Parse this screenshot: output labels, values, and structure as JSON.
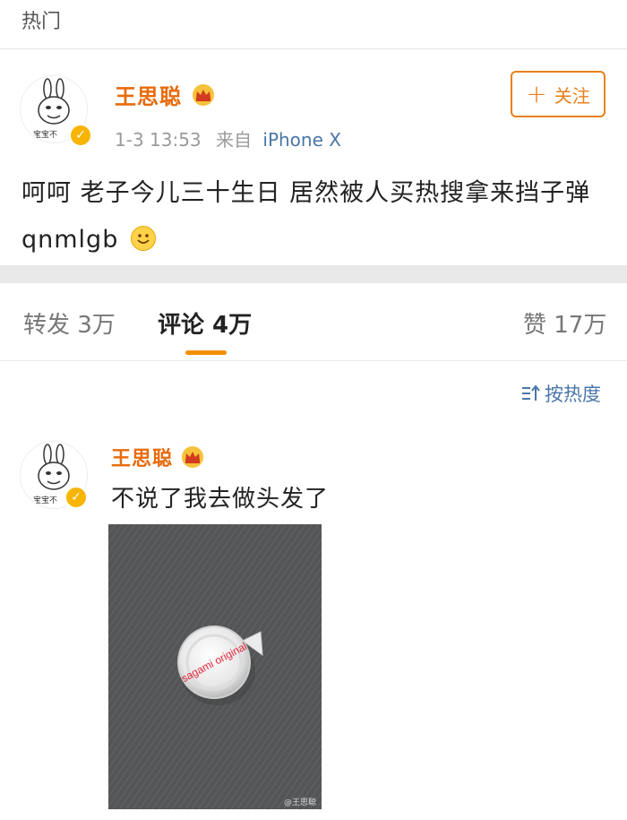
{
  "header": {
    "section_label": "热门"
  },
  "post": {
    "username": "王思聪",
    "avatar_caption": "宝宝不",
    "time": "1-3 13:53",
    "source_prefix": "来自",
    "source_device": "iPhone X",
    "follow_label": "关注",
    "text": "呵呵 老子今儿三十生日 居然被人买热搜拿来挡子弹 qnmlgb",
    "emoji": "smiley-face-icon"
  },
  "tabs": {
    "repost": "转发 3万",
    "comments": "评论 4万",
    "likes": "赞 17万",
    "active": "comments"
  },
  "sort": {
    "label": "按热度"
  },
  "comment": {
    "username": "王思聪",
    "avatar_caption": "宝宝不",
    "text": "不说了我去做头发了",
    "image_product_text": "sagami original",
    "image_watermark": "@王思聪"
  },
  "colors": {
    "username": "#e86b0c",
    "accent": "#f29100",
    "follow": "#e7811c",
    "link": "#4a76a8",
    "verified": "#f7b500"
  }
}
